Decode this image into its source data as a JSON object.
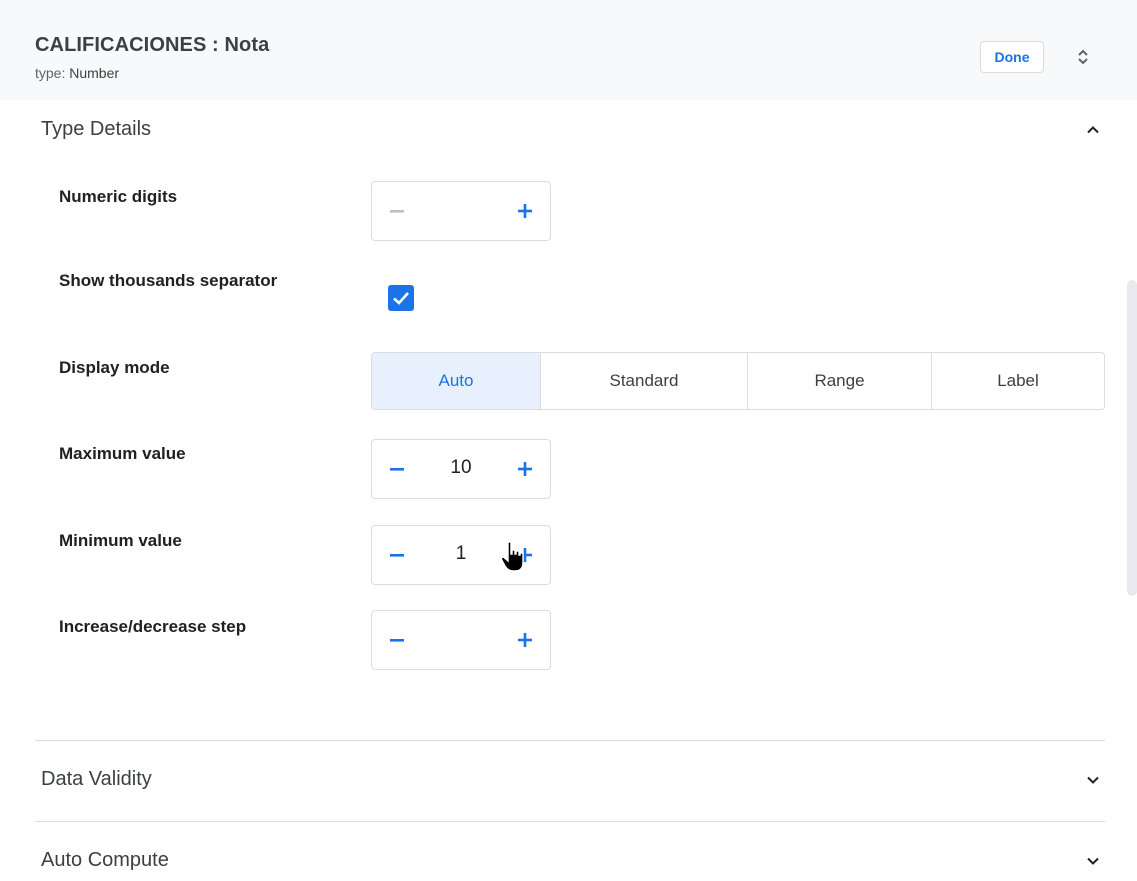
{
  "header": {
    "title": "CALIFICACIONES : Nota",
    "type_prefix": "type: ",
    "type_value": "Number",
    "done_label": "Done"
  },
  "sections": {
    "type_details": "Type Details",
    "data_validity": "Data Validity",
    "auto_compute": "Auto Compute"
  },
  "fields": {
    "numeric_digits": {
      "label": "Numeric digits",
      "value": ""
    },
    "thousands_separator": {
      "label": "Show thousands separator",
      "checked": true
    },
    "display_mode": {
      "label": "Display mode",
      "options": [
        "Auto",
        "Standard",
        "Range",
        "Label"
      ],
      "selected": "Auto"
    },
    "maximum_value": {
      "label": "Maximum value",
      "value": "10"
    },
    "minimum_value": {
      "label": "Minimum value",
      "value": "1"
    },
    "step": {
      "label": "Increase/decrease step",
      "value": ""
    }
  },
  "colors": {
    "accent": "#1a73e8",
    "disabled": "#bdc1c6",
    "border": "#dadce0",
    "active_segment_bg": "#e8f0fe"
  },
  "icons": {
    "expand": "unfold-more-icon",
    "collapse": "chevron-up-icon",
    "expand_section": "chevron-down-icon",
    "minus": "minus-icon",
    "plus": "plus-icon",
    "check": "check-icon",
    "cursor": "hand-pointer-icon"
  }
}
